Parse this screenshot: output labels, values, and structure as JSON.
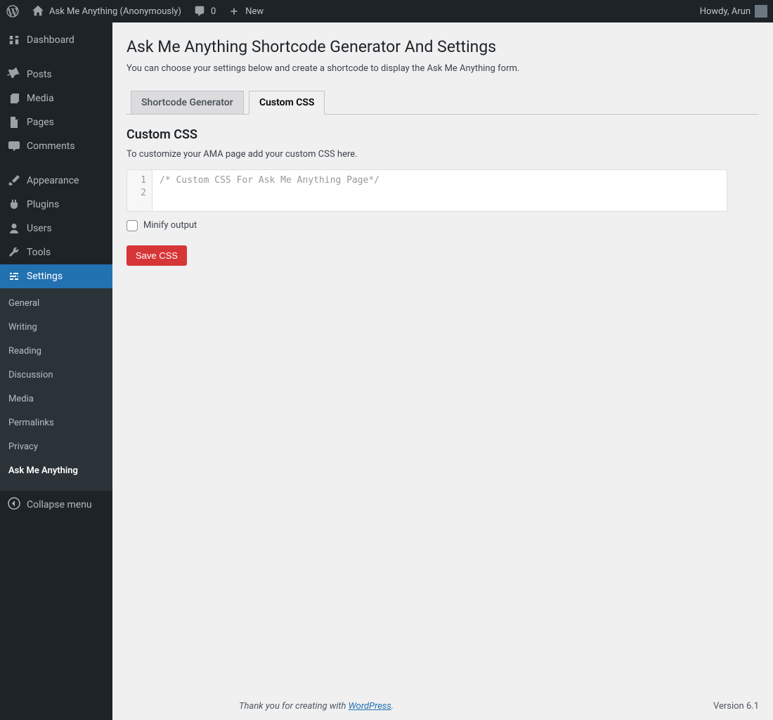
{
  "adminbar": {
    "site_name": "Ask Me Anything (Anonymously)",
    "comments_count": "0",
    "new_label": "New",
    "howdy": "Howdy, Arun"
  },
  "sidebar": {
    "items": [
      {
        "id": "dashboard",
        "label": "Dashboard"
      },
      {
        "id": "posts",
        "label": "Posts"
      },
      {
        "id": "media",
        "label": "Media"
      },
      {
        "id": "pages",
        "label": "Pages"
      },
      {
        "id": "comments",
        "label": "Comments"
      },
      {
        "id": "appearance",
        "label": "Appearance"
      },
      {
        "id": "plugins",
        "label": "Plugins"
      },
      {
        "id": "users",
        "label": "Users"
      },
      {
        "id": "tools",
        "label": "Tools"
      },
      {
        "id": "settings",
        "label": "Settings"
      }
    ],
    "settings_sub": [
      "General",
      "Writing",
      "Reading",
      "Discussion",
      "Media",
      "Permalinks",
      "Privacy",
      "Ask Me Anything"
    ],
    "collapse_label": "Collapse menu"
  },
  "page": {
    "title": "Ask Me Anything Shortcode Generator And Settings",
    "description": "You can choose your settings below and create a shortcode to display the Ask Me Anything form.",
    "tabs": {
      "shortcode": "Shortcode Generator",
      "custom_css": "Custom CSS"
    },
    "section_heading": "Custom CSS",
    "section_desc": "To customize your AMA page add your custom CSS here.",
    "editor": {
      "lines": [
        "1",
        "2"
      ],
      "content": "/* Custom CSS For Ask Me Anything Page*/"
    },
    "minify_label": "Minify output",
    "save_button": "Save CSS"
  },
  "footer": {
    "thank_prefix": "Thank you for creating with ",
    "wp": "WordPress",
    "version": "Version 6.1"
  }
}
